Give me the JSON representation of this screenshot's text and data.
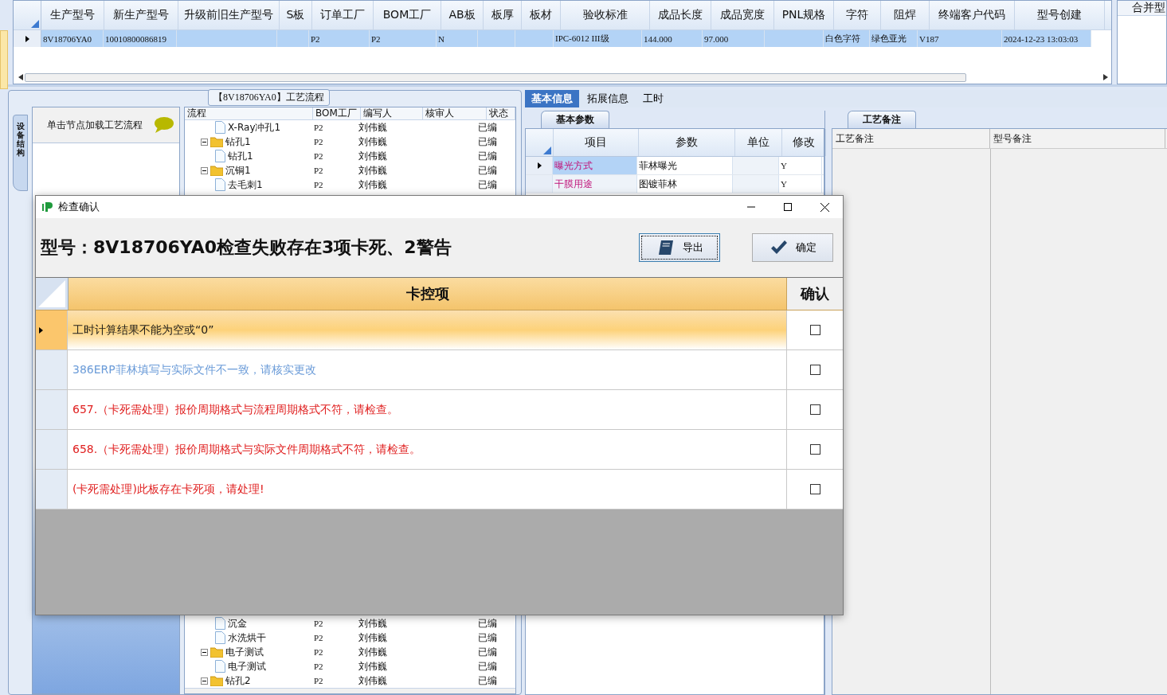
{
  "main_grid": {
    "columns": [
      "生产型号",
      "新生产型号",
      "升级前旧生产型号",
      "S板",
      "订单工厂",
      "BOM工厂",
      "AB板",
      "板厚",
      "板材",
      "验收标准",
      "成品长度",
      "成品宽度",
      "PNL规格",
      "字符",
      "阻焊",
      "终端客户代码",
      "型号创建"
    ],
    "rows": [
      {
        "selected": true,
        "cells": [
          "8V18706YA0",
          "10010800086819",
          "",
          "",
          "P2",
          "P2",
          "N",
          "",
          "",
          "IPC-6012 III级",
          "144.000",
          "97.000",
          "",
          "白色字符",
          "绿色亚光",
          "V187",
          "2024-12-23 13:03:03"
        ]
      }
    ]
  },
  "side_grid": {
    "column": "合并型"
  },
  "process_panel": {
    "title": "【8V18706YA0】工艺流程",
    "vertical_tab": "设备结构",
    "hint": "单击节点加载工艺流程",
    "columns": [
      "流程",
      "BOM工厂",
      "编写人",
      "核审人",
      "状态"
    ],
    "top_rows": [
      {
        "kind": "file",
        "label": "X-Ray冲孔1",
        "bom": "P2",
        "author": "刘伟巍",
        "status": "已编"
      },
      {
        "kind": "folder",
        "expanded": true,
        "label": "钻孔1",
        "bom": "P2",
        "author": "刘伟巍",
        "status": "已编",
        "children": [
          {
            "kind": "file",
            "label": "钻孔1",
            "bom": "P2",
            "author": "刘伟巍",
            "status": "已编"
          }
        ]
      },
      {
        "kind": "folder",
        "expanded": true,
        "label": "沉铜1",
        "bom": "P2",
        "author": "刘伟巍",
        "status": "已编",
        "children": [
          {
            "kind": "file",
            "label": "去毛刺1",
            "bom": "P2",
            "author": "刘伟巍",
            "status": "已编"
          }
        ]
      }
    ],
    "bottom_rows": [
      {
        "kind": "file",
        "label": "沉金",
        "bom": "P2",
        "author": "刘伟巍",
        "status": "已编"
      },
      {
        "kind": "file",
        "label": "水洗烘干",
        "bom": "P2",
        "author": "刘伟巍",
        "status": "已编"
      },
      {
        "kind": "folder",
        "expanded": true,
        "label": "电子测试",
        "bom": "P2",
        "author": "刘伟巍",
        "status": "已编",
        "children": [
          {
            "kind": "file",
            "label": "电子测试",
            "bom": "P2",
            "author": "刘伟巍",
            "status": "已编"
          }
        ]
      },
      {
        "kind": "folder",
        "expanded": true,
        "label": "钻孔2",
        "bom": "P2",
        "author": "刘伟巍",
        "status": "已编"
      }
    ]
  },
  "info_panel": {
    "tabs": [
      {
        "label": "基本信息",
        "selected": true
      },
      {
        "label": "拓展信息",
        "selected": false
      },
      {
        "label": "工时",
        "selected": false
      }
    ],
    "params": {
      "tab": "基本参数",
      "columns": [
        "项目",
        "参数",
        "单位",
        "修改"
      ],
      "rows": [
        {
          "selected": true,
          "item": "曝光方式",
          "value": "菲林曝光",
          "unit": "",
          "modify": "Y"
        },
        {
          "selected": false,
          "item": "干膜用途",
          "value": "图镀菲林",
          "unit": "",
          "modify": "Y"
        }
      ]
    },
    "notes": {
      "tab": "工艺备注",
      "columns": [
        "工艺备注",
        "型号备注"
      ]
    }
  },
  "dialog": {
    "title": "检查确认",
    "heading": "型号：8V18706YA0检查失败存在3项卡死、2警告",
    "buttons": [
      "导出",
      "确定"
    ],
    "columns": [
      "卡控项",
      "确认"
    ],
    "rows": [
      {
        "selected": true,
        "text": "工时计算结果不能为空或“0”",
        "color": "#1a1a1a",
        "checked": false
      },
      {
        "selected": false,
        "text": "386ERP菲林填写与实际文件不一致，请核实更改",
        "color": "#6a9bd8",
        "checked": false
      },
      {
        "selected": false,
        "text": "657.（卡死需处理）报价周期格式与流程周期格式不符，请检查。",
        "color": "#e02020",
        "checked": false
      },
      {
        "selected": false,
        "text": "658.（卡死需处理）报价周期格式与实际文件周期格式不符，请检查。",
        "color": "#e02020",
        "checked": false
      },
      {
        "selected": false,
        "text": "(卡死需处理)此板存在卡死项，请处理!",
        "color": "#e02020",
        "checked": false
      }
    ]
  }
}
